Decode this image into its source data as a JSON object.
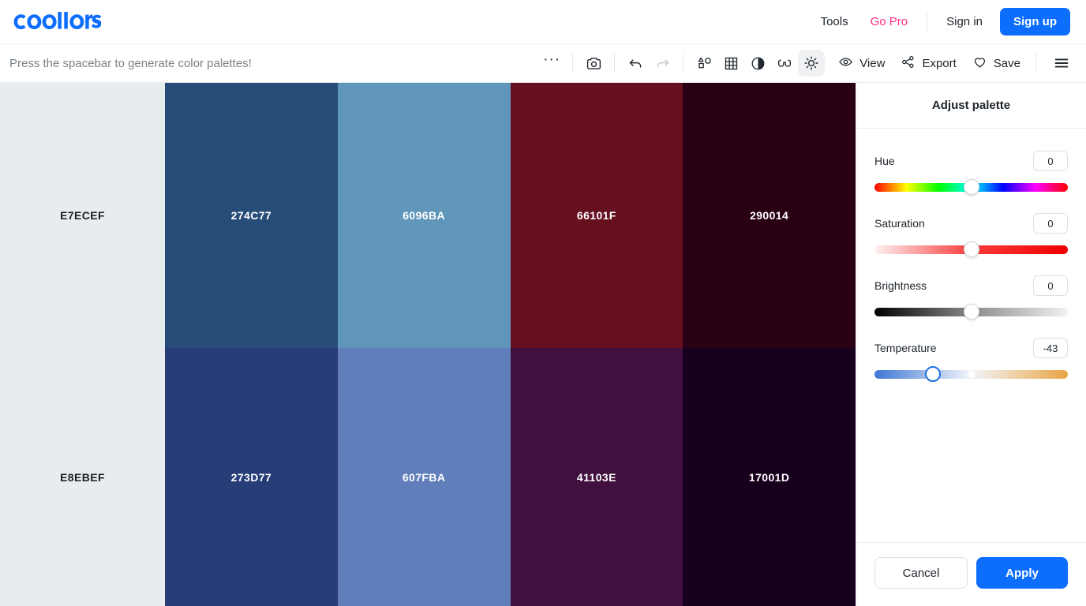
{
  "nav": {
    "logo_text": "coolors",
    "logo_color": "#0d6efd",
    "tools_label": "Tools",
    "gopro_label": "Go Pro",
    "gopro_color": "#ff2e86",
    "signin_label": "Sign in",
    "signup_label": "Sign up",
    "signup_color": "#0d6efd"
  },
  "toolbar": {
    "hint": "Press the spacebar to generate color palettes!",
    "more_label": "···",
    "icons": [
      {
        "name": "camera-icon",
        "title": "Camera"
      },
      {
        "name": "undo-icon",
        "title": "Undo",
        "state": "enabled"
      },
      {
        "name": "redo-icon",
        "title": "Redo",
        "state": "disabled"
      },
      {
        "name": "shapes-icon",
        "title": "Adjust shapes"
      },
      {
        "name": "grid-icon",
        "title": "Grid view"
      },
      {
        "name": "contrast-icon",
        "title": "Contrast checker"
      },
      {
        "name": "glasses-icon",
        "title": "Color blindness"
      },
      {
        "name": "brightness-icon",
        "title": "Adjust palette",
        "state": "active"
      }
    ],
    "view_label": "View",
    "export_label": "Export",
    "save_label": "Save"
  },
  "palette": {
    "columns": [
      {
        "top": {
          "hex": "E7ECEF",
          "fill": "#E7ECEF",
          "text": "#1b1f23"
        },
        "bottom": {
          "hex": "E8EBEF",
          "fill": "#E8EBEF",
          "text": "#1b1f23"
        }
      },
      {
        "top": {
          "hex": "274C77",
          "fill": "#274C77",
          "text": "#ffffff"
        },
        "bottom": {
          "hex": "273D77",
          "fill": "#273D77",
          "text": "#ffffff"
        }
      },
      {
        "top": {
          "hex": "6096BA",
          "fill": "#6096BA",
          "text": "#ffffff"
        },
        "bottom": {
          "hex": "607FBA",
          "fill": "#607FBA",
          "text": "#ffffff"
        }
      },
      {
        "top": {
          "hex": "66101F",
          "fill": "#66101F",
          "text": "#ffffff"
        },
        "bottom": {
          "hex": "41103E",
          "fill": "#41103E",
          "text": "#ffffff"
        }
      },
      {
        "top": {
          "hex": "290014",
          "fill": "#290014",
          "text": "#ffffff"
        },
        "bottom": {
          "hex": "17001D",
          "fill": "#17001D",
          "text": "#ffffff"
        }
      }
    ]
  },
  "panel": {
    "title": "Adjust palette",
    "controls": [
      {
        "label": "Hue",
        "value": "0",
        "knob_pct": 50,
        "track": "hue",
        "selected": false,
        "tick": false
      },
      {
        "label": "Saturation",
        "value": "0",
        "knob_pct": 50,
        "track": "sat",
        "selected": false,
        "tick": false
      },
      {
        "label": "Brightness",
        "value": "0",
        "knob_pct": 50,
        "track": "bri",
        "selected": false,
        "tick": false
      },
      {
        "label": "Temperature",
        "value": "-43",
        "knob_pct": 30,
        "track": "tmp",
        "selected": true,
        "tick": true,
        "tick_pct": 50
      }
    ],
    "cancel_label": "Cancel",
    "apply_label": "Apply"
  }
}
